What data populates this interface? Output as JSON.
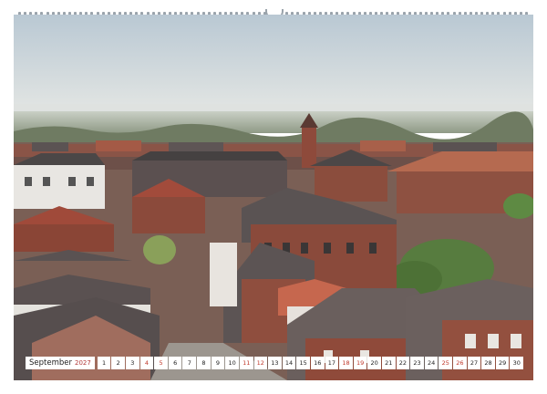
{
  "calendar": {
    "month": "September",
    "year": "2027",
    "days": [
      {
        "n": "1",
        "weekend": false
      },
      {
        "n": "2",
        "weekend": false
      },
      {
        "n": "3",
        "weekend": false
      },
      {
        "n": "4",
        "weekend": true
      },
      {
        "n": "5",
        "weekend": true
      },
      {
        "n": "6",
        "weekend": false
      },
      {
        "n": "7",
        "weekend": false
      },
      {
        "n": "8",
        "weekend": false
      },
      {
        "n": "9",
        "weekend": false
      },
      {
        "n": "10",
        "weekend": false
      },
      {
        "n": "11",
        "weekend": true
      },
      {
        "n": "12",
        "weekend": true
      },
      {
        "n": "13",
        "weekend": false
      },
      {
        "n": "14",
        "weekend": false
      },
      {
        "n": "15",
        "weekend": false
      },
      {
        "n": "16",
        "weekend": false
      },
      {
        "n": "17",
        "weekend": false
      },
      {
        "n": "18",
        "weekend": true
      },
      {
        "n": "19",
        "weekend": true
      },
      {
        "n": "20",
        "weekend": false
      },
      {
        "n": "21",
        "weekend": false
      },
      {
        "n": "22",
        "weekend": false
      },
      {
        "n": "23",
        "weekend": false
      },
      {
        "n": "24",
        "weekend": false
      },
      {
        "n": "25",
        "weekend": true
      },
      {
        "n": "26",
        "weekend": true
      },
      {
        "n": "27",
        "weekend": false
      },
      {
        "n": "28",
        "weekend": false
      },
      {
        "n": "29",
        "weekend": false
      },
      {
        "n": "30",
        "weekend": false
      }
    ]
  },
  "colors": {
    "sky_top": "#b9c8d3",
    "sky_horizon": "#dfe3e2",
    "roof_brick": "#9e4b3b",
    "roof_dark": "#4d4a4a",
    "wall_brick": "#8d4a3a",
    "weekend_red": "#c0392b"
  }
}
